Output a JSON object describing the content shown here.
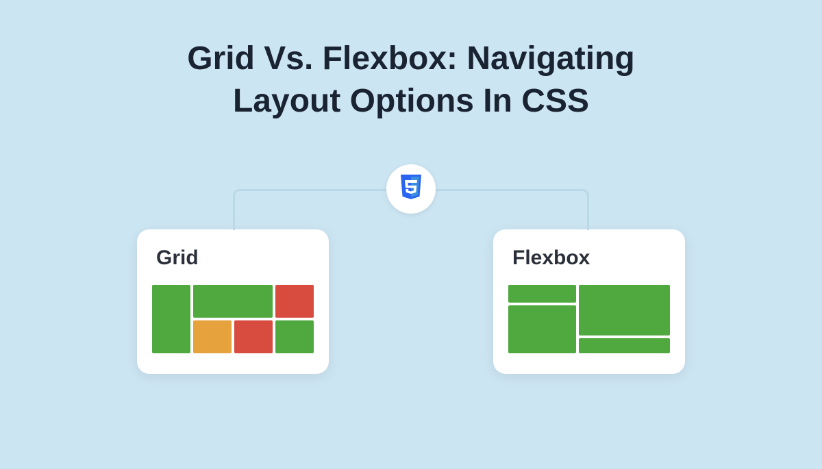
{
  "title_line1": "Grid Vs. Flexbox: Navigating",
  "title_line2": "Layout Options In CSS",
  "badge": {
    "label": "CSS3"
  },
  "cards": {
    "grid": {
      "title": "Grid"
    },
    "flexbox": {
      "title": "Flexbox"
    }
  },
  "colors": {
    "bg": "#cce5f2",
    "green": "#4fa93f",
    "red": "#d84b3f",
    "orange": "#e6a23c",
    "connector": "#b9d8e8"
  }
}
